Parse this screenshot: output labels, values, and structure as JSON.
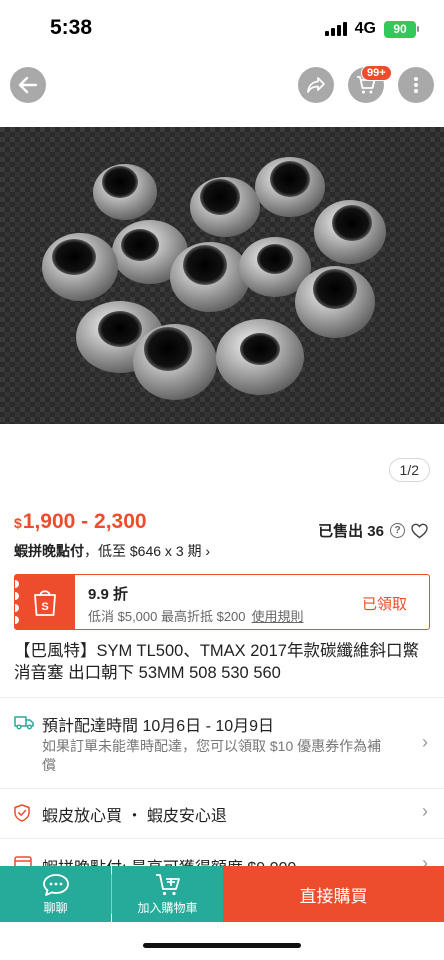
{
  "status_bar": {
    "time": "5:38",
    "network": "4G",
    "battery": "90"
  },
  "top_nav": {
    "cart_badge": "99+"
  },
  "gallery": {
    "page_counter": "1/2"
  },
  "price": {
    "currency": "$",
    "range": "1,900 - 2,300"
  },
  "sold": {
    "label": "已售出 36"
  },
  "installment": {
    "brand": "蝦拼晚點付",
    "text": "，低至 $646 x 3 期 ›"
  },
  "voucher": {
    "rate": "9.9 折",
    "conditions": "低消 $5,000 最高折抵 $200",
    "rules_link": "使用規則",
    "status": "已領取"
  },
  "product": {
    "title": "【巴風特】SYM TL500、TMAX 2017年款碳纖維斜口鱉消音塞 出口朝下 53MM  508  530 560"
  },
  "delivery": {
    "title": "預計配達時間 10月6日 - 10月9日",
    "note": "如果訂單未能準時配達，您可以領取 $10 優惠券作為補償"
  },
  "guarantee": {
    "text": "蝦皮放心買 ・ 蝦皮安心退"
  },
  "paylater": {
    "text": "蝦拼晚點付: 最高可獲得額度 $9,000"
  },
  "bottom_bar": {
    "chat_label": "聊聊",
    "add_cart_label": "加入購物車",
    "buy_label": "直接購買"
  },
  "colors": {
    "brand": "#ee4d2d",
    "action_teal": "#26aa99"
  }
}
